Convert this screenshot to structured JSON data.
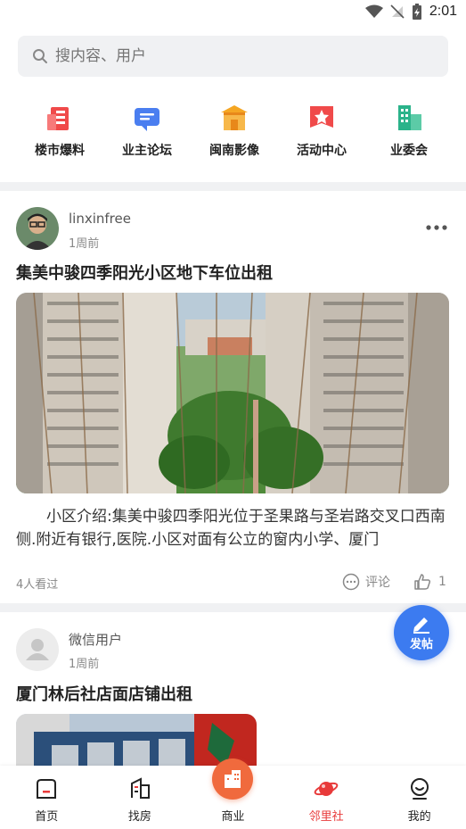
{
  "status_bar": {
    "time": "2:01"
  },
  "search": {
    "placeholder": "搜内容、用户"
  },
  "quick_nav": [
    {
      "label": "楼市爆料",
      "icon": "building-news-icon",
      "color": "#f04a4a"
    },
    {
      "label": "业主论坛",
      "icon": "chat-bubble-icon",
      "color": "#4a7ef0"
    },
    {
      "label": "闽南影像",
      "icon": "temple-icon",
      "color": "#f5a623"
    },
    {
      "label": "活动中心",
      "icon": "star-flag-icon",
      "color": "#f04a4a"
    },
    {
      "label": "业委会",
      "icon": "office-building-icon",
      "color": "#2bb38a"
    }
  ],
  "posts": [
    {
      "author": "linxinfree",
      "time": "1周前",
      "title": "集美中骏四季阳光小区地下车位出租",
      "excerpt": "小区介绍:集美中骏四季阳光位于圣果路与圣岩路交叉口西南侧.附近有银行,医院.小区对面有公立的窗内小学、厦门",
      "views": "4人看过",
      "comment_label": "评论",
      "likes": "1"
    },
    {
      "author": "微信用户",
      "time": "1周前",
      "title": "厦门林后社店面店铺出租"
    }
  ],
  "fab": {
    "label": "发帖"
  },
  "tabs": [
    {
      "label": "首页",
      "icon": "home-icon",
      "active": false
    },
    {
      "label": "找房",
      "icon": "building-search-icon",
      "active": false
    },
    {
      "label": "商业",
      "icon": "commerce-building-icon",
      "active": false
    },
    {
      "label": "邻里社",
      "icon": "planet-icon",
      "active": true
    },
    {
      "label": "我的",
      "icon": "profile-icon",
      "active": false
    }
  ],
  "colors": {
    "accent_red": "#e83a3a",
    "fab_blue": "#3c7bf0",
    "center_orange": "#f06a3d"
  }
}
